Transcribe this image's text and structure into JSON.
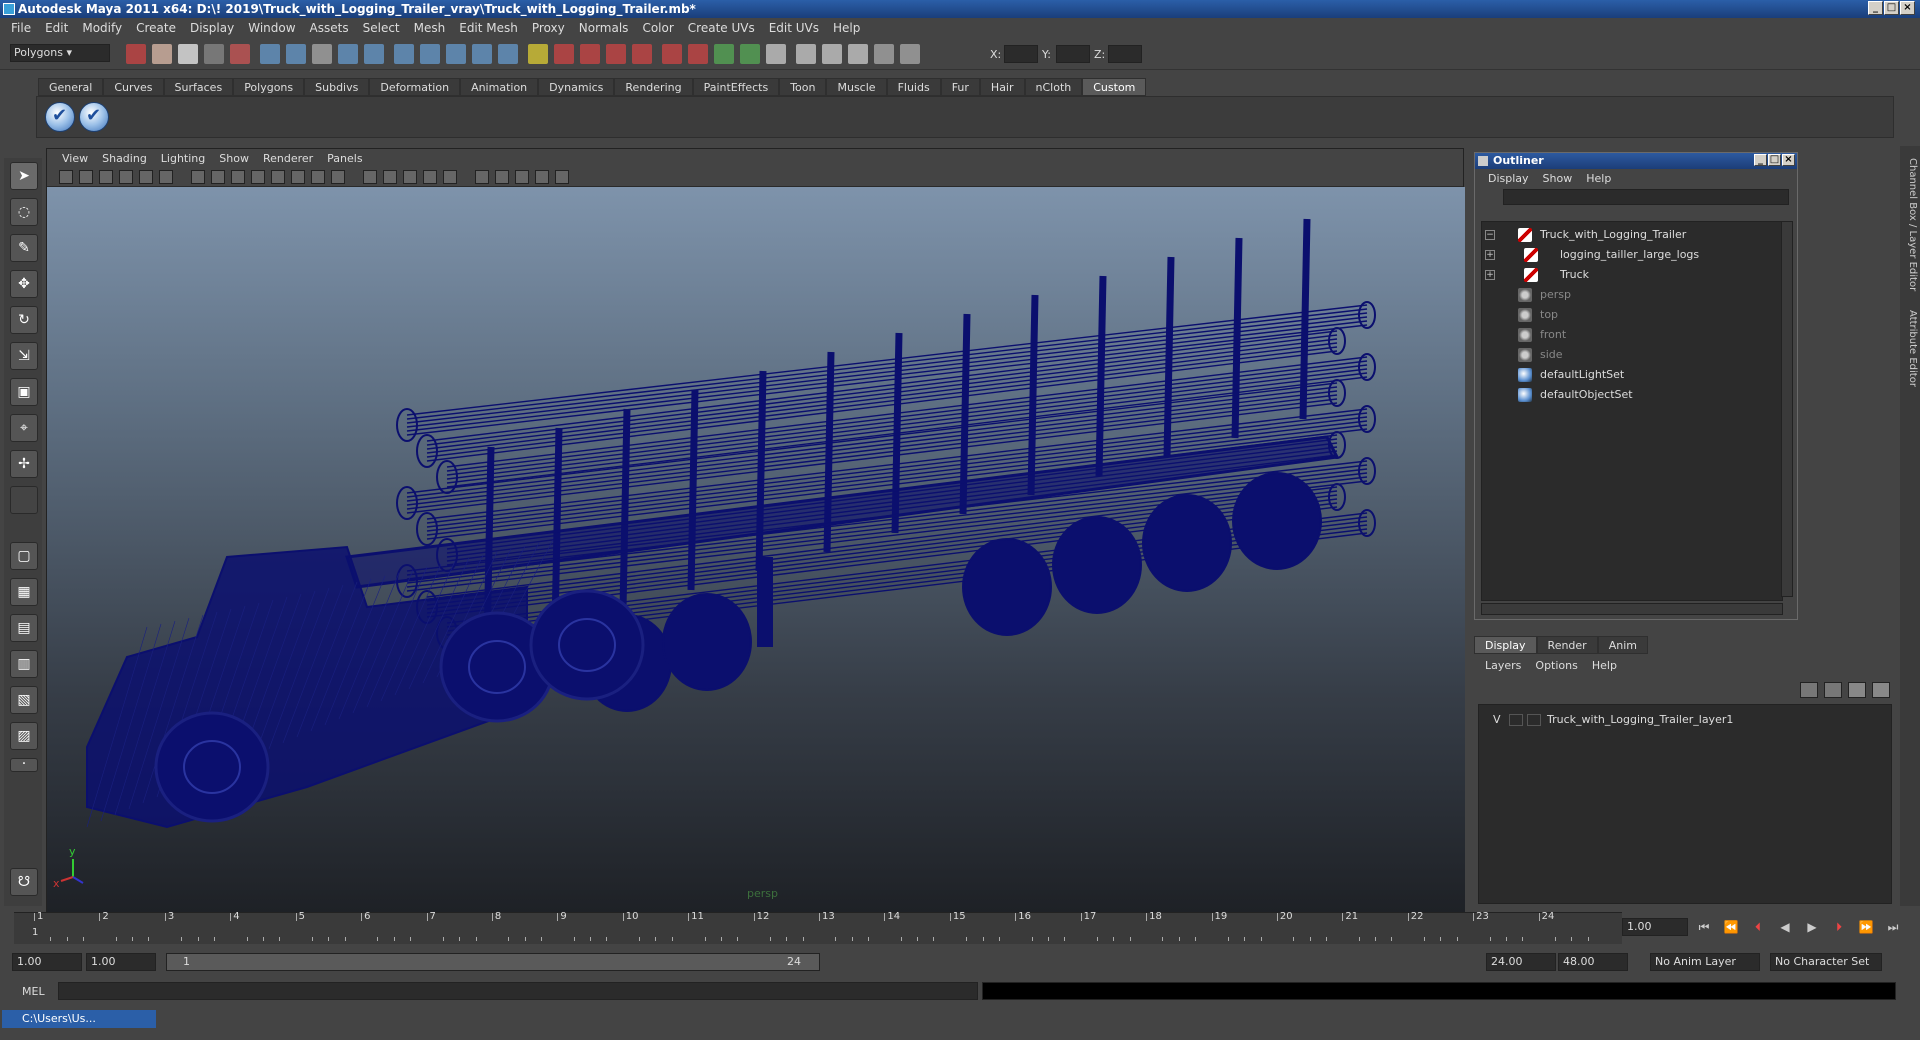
{
  "window": {
    "title": "Autodesk Maya 2011 x64: D:\\! 2019\\Truck_with_Logging_Trailer_vray\\Truck_with_Logging_Trailer.mb*"
  },
  "menubar": [
    "File",
    "Edit",
    "Modify",
    "Create",
    "Display",
    "Window",
    "Assets",
    "Select",
    "Mesh",
    "Edit Mesh",
    "Proxy",
    "Normals",
    "Color",
    "Create UVs",
    "Edit UVs",
    "Help"
  ],
  "statusline": {
    "mode": "Polygons",
    "x_label": "X:",
    "y_label": "Y:",
    "z_label": "Z:"
  },
  "shelf": {
    "tabs": [
      "General",
      "Curves",
      "Surfaces",
      "Polygons",
      "Subdivs",
      "Deformation",
      "Animation",
      "Dynamics",
      "Rendering",
      "PaintEffects",
      "Toon",
      "Muscle",
      "Fluids",
      "Fur",
      "Hair",
      "nCloth",
      "Custom"
    ],
    "active_tab": "Custom"
  },
  "viewport": {
    "menu": [
      "View",
      "Shading",
      "Lighting",
      "Show",
      "Renderer",
      "Panels"
    ],
    "camera": "persp",
    "axis_x": "x",
    "axis_y": "y"
  },
  "outliner": {
    "title": "Outliner",
    "menu": [
      "Display",
      "Show",
      "Help"
    ],
    "items": [
      {
        "label": "Truck_with_Logging_Trailer",
        "icon": "transform-icon",
        "expand": "−"
      },
      {
        "label": "logging_tailler_large_logs",
        "icon": "transform-icon",
        "expand": "+"
      },
      {
        "label": "Truck",
        "icon": "transform-icon",
        "expand": "+"
      },
      {
        "label": "persp",
        "icon": "camera-icon",
        "expand": ""
      },
      {
        "label": "top",
        "icon": "camera-icon",
        "expand": ""
      },
      {
        "label": "front",
        "icon": "camera-icon",
        "expand": ""
      },
      {
        "label": "side",
        "icon": "camera-icon",
        "expand": ""
      },
      {
        "label": "defaultLightSet",
        "icon": "set-icon",
        "expand": ""
      },
      {
        "label": "defaultObjectSet",
        "icon": "set-icon",
        "expand": ""
      }
    ]
  },
  "layers": {
    "tabs": [
      "Display",
      "Render",
      "Anim"
    ],
    "active_tab": "Display",
    "menu": [
      "Layers",
      "Options",
      "Help"
    ],
    "rows": [
      {
        "visible": "V",
        "name": "Truck_with_Logging_Trailer_layer1"
      }
    ]
  },
  "sidetabs": [
    "Channel Box / Layer Editor",
    "Attribute Editor"
  ],
  "timeline": {
    "ticks": [
      "1",
      "2",
      "3",
      "4",
      "5",
      "6",
      "7",
      "8",
      "9",
      "10",
      "11",
      "12",
      "13",
      "14",
      "15",
      "16",
      "17",
      "18",
      "19",
      "20",
      "21",
      "22",
      "23",
      "24"
    ],
    "first_frame": "1",
    "current_frame": "1.00"
  },
  "range": {
    "start": "1.00",
    "playback_start": "1.00",
    "slider_start": "1",
    "slider_end": "24",
    "playback_end": "24.00",
    "end": "48.00",
    "anim_layer": "No Anim Layer",
    "char_set": "No Character Set"
  },
  "cmdline": {
    "label": "MEL"
  },
  "taskbar": {
    "window_label": "C:\\Users\\Us..."
  },
  "colors": {
    "wireframe": "#0b0f6e",
    "title_blue": "#2b5fa8",
    "ui_gray": "#444444"
  }
}
